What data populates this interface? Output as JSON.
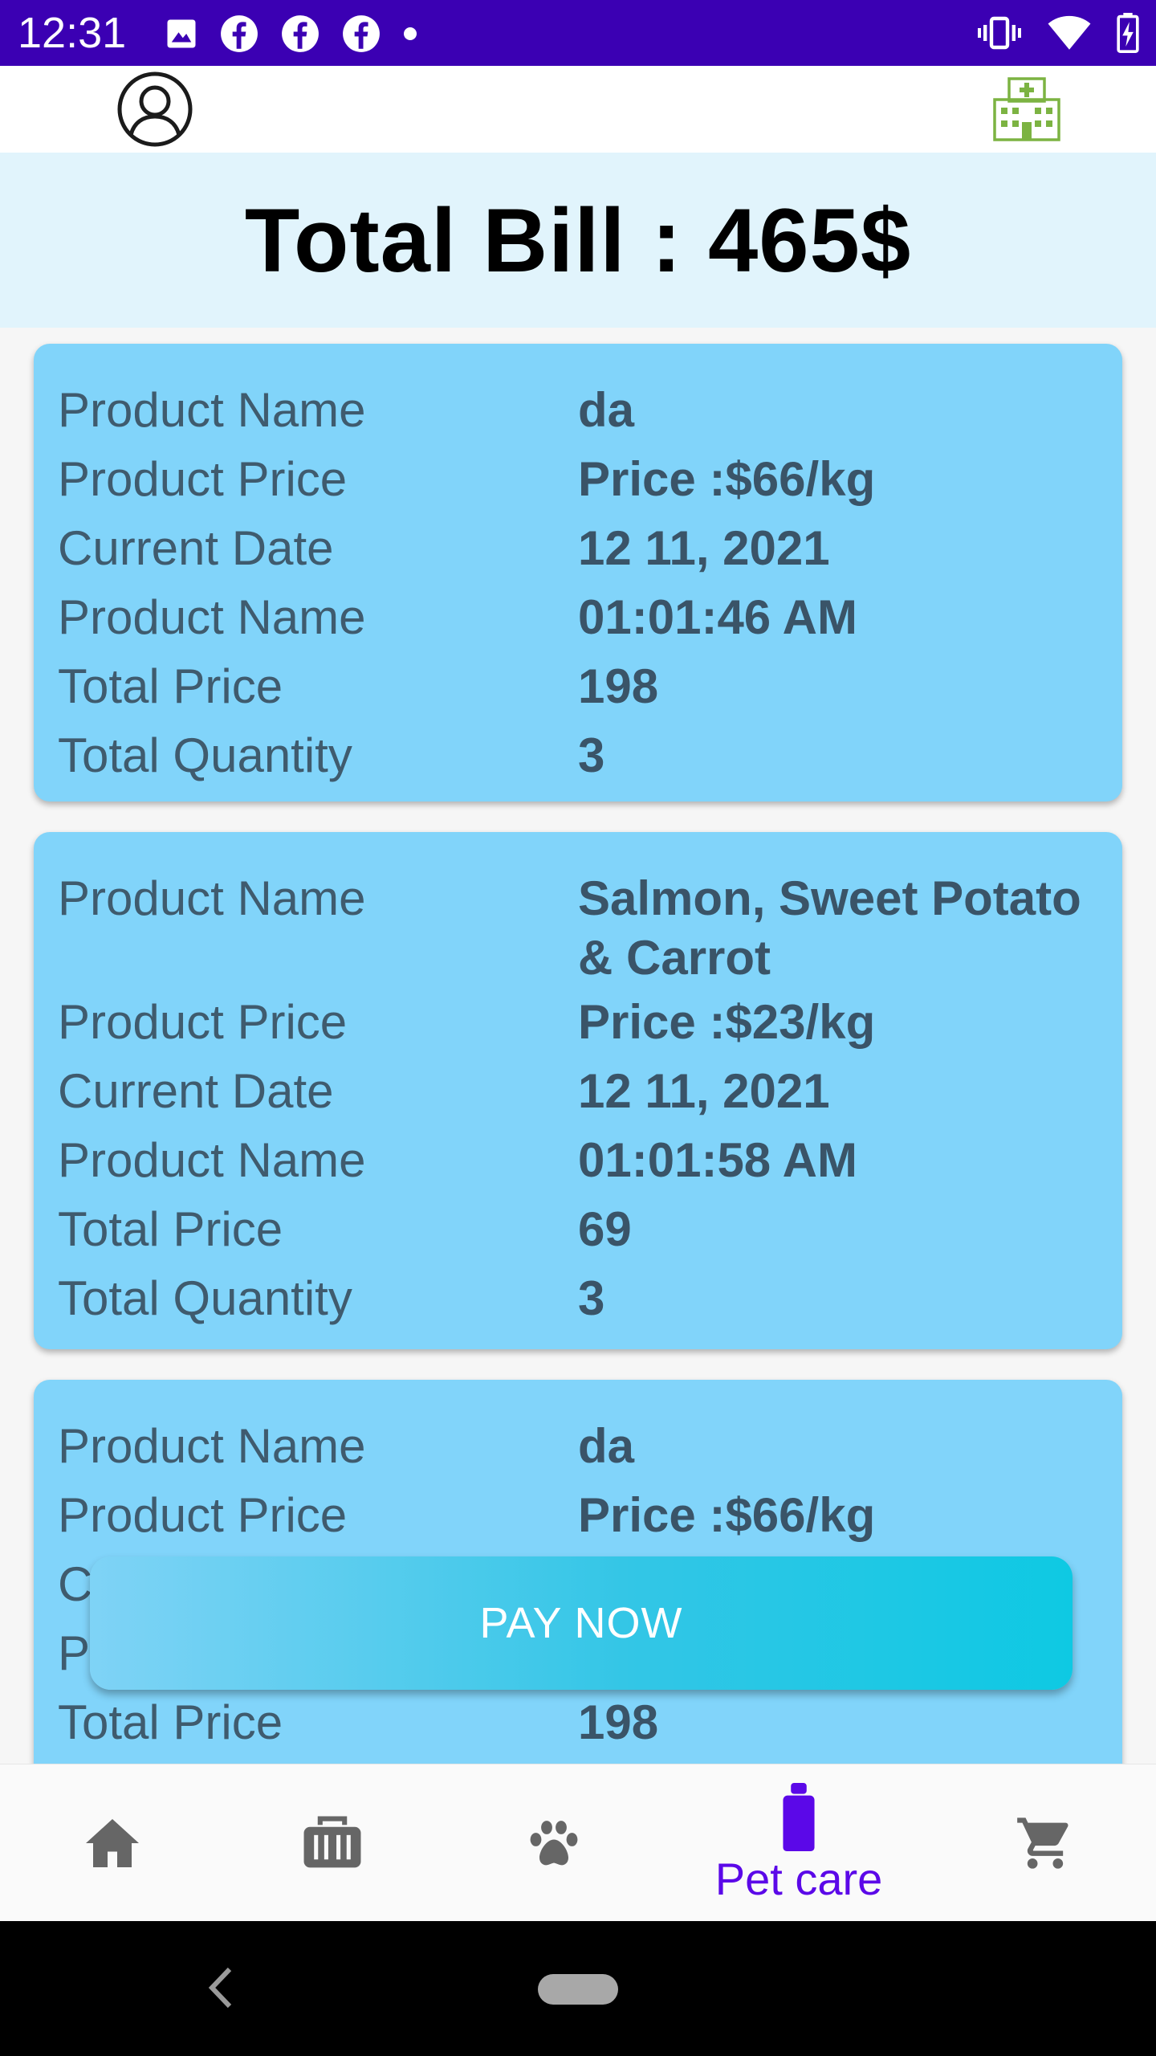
{
  "status_bar": {
    "time": "12:31",
    "left_icons": [
      "image-icon",
      "facebook-icon",
      "facebook-icon",
      "facebook-icon",
      "dot-icon"
    ],
    "right_icons": [
      "vibrate-icon",
      "wifi-icon",
      "battery-charging-icon"
    ],
    "background": "#3b00b3"
  },
  "app_bar": {
    "left_icon": "profile-icon",
    "right_icon": "hospital-icon"
  },
  "summary": {
    "total_bill": "Total Bill : 465$"
  },
  "orders": [
    {
      "rows": [
        {
          "label": "Product Name",
          "value": "da"
        },
        {
          "label": "Product Price",
          "value": "Price :$66/kg"
        },
        {
          "label": "Current Date",
          "value": "12 11, 2021"
        },
        {
          "label": "Product Name",
          "value": "01:01:46 AM"
        },
        {
          "label": "Total Price",
          "value": "198"
        },
        {
          "label": "Total Quantity",
          "value": "3"
        }
      ]
    },
    {
      "rows": [
        {
          "label": "Product Name",
          "value": "Salmon, Sweet Potato & Carrot"
        },
        {
          "label": "Product Price",
          "value": "Price :$23/kg"
        },
        {
          "label": "Current Date",
          "value": "12 11, 2021"
        },
        {
          "label": "Product Name",
          "value": "01:01:58 AM"
        },
        {
          "label": "Total Price",
          "value": "69"
        },
        {
          "label": "Total Quantity",
          "value": "3"
        }
      ]
    },
    {
      "rows": [
        {
          "label": "Product Name",
          "value": "da"
        },
        {
          "label": "Product Price",
          "value": "Price :$66/kg"
        },
        {
          "label": "C",
          "value": ""
        },
        {
          "label": "P",
          "value": ""
        },
        {
          "label": "Total Price",
          "value": "198"
        },
        {
          "label": "",
          "value": ""
        }
      ]
    }
  ],
  "pay_button": {
    "label": "PAY NOW"
  },
  "bottom_nav": {
    "items": [
      {
        "icon": "home-icon",
        "label": "",
        "active": false
      },
      {
        "icon": "pet-carrier-icon",
        "label": "",
        "active": false
      },
      {
        "icon": "paw-icon",
        "label": "",
        "active": false
      },
      {
        "icon": "bottle-icon",
        "label": "Pet care",
        "active": true
      },
      {
        "icon": "cart-icon",
        "label": "",
        "active": false
      }
    ],
    "active_color": "#5b08e8",
    "inactive_color": "#666666"
  },
  "colors": {
    "card": "#81d4fa",
    "summary_band": "#e1f4fc",
    "hospital_icon": "#7cb342"
  }
}
